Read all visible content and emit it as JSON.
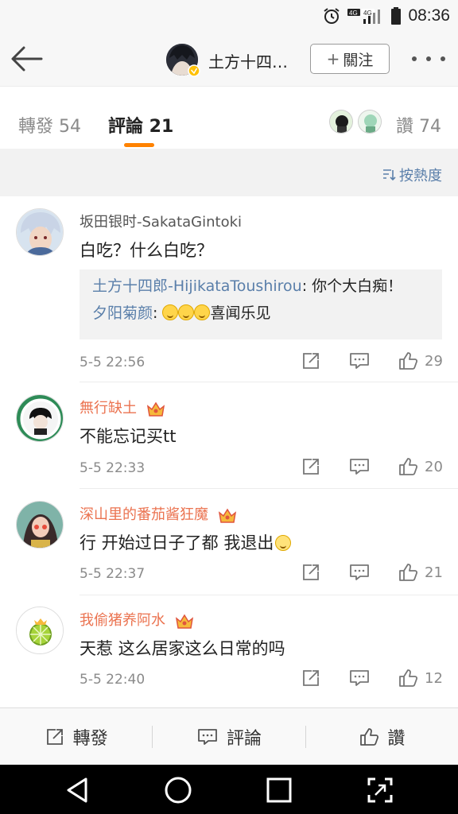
{
  "status_bar": {
    "time": "08:36",
    "network_1": "4G",
    "network_2": "4G"
  },
  "nav": {
    "title": "土方十四…",
    "follow_label": "關注"
  },
  "tabs": {
    "repost": "轉發 54",
    "comment": "評論 21",
    "likes": "讚 74"
  },
  "sort": {
    "label": "按熱度"
  },
  "comments": [
    {
      "name": "坂田银时-SakataGintoki",
      "text": "白吃？什么白吃？",
      "replies": [
        {
          "user": "土方十四郎-HijikataToushirou",
          "text": ": 你个大白痴！"
        },
        {
          "user": "夕阳菊颜",
          "text": ": ",
          "emojis": 3,
          "tail": "喜闻乐见"
        }
      ],
      "time": "5-5 22:56",
      "likes": "29"
    },
    {
      "name": "無行缺土",
      "text": "不能忘记买tt",
      "time": "5-5 22:33",
      "likes": "20"
    },
    {
      "name": "深山里的番茄酱狂魔",
      "text": "行  开始过日子了都  我退出",
      "time": "5-5 22:37",
      "likes": "21"
    },
    {
      "name": "我偷猪养阿水",
      "text": "天惹 这么居家这么日常的吗",
      "time": "5-5 22:40",
      "likes": "12"
    }
  ],
  "bottom_bar": {
    "repost": "轉發",
    "comment": "評論",
    "like": "讚"
  },
  "colors": {
    "accent": "#ff8200",
    "link": "#5a7faa",
    "member_name": "#eb7350"
  }
}
